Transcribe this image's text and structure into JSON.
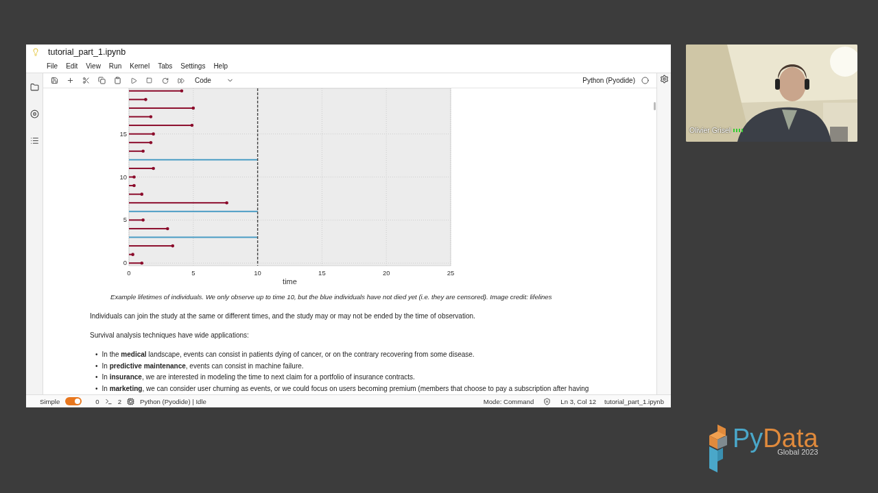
{
  "window": {
    "title": "tutorial_part_1.ipynb"
  },
  "menu": [
    "File",
    "Edit",
    "View",
    "Run",
    "Kernel",
    "Tabs",
    "Settings",
    "Help"
  ],
  "toolbar": {
    "cell_type": "Code",
    "kernel": "Python (Pyodide)"
  },
  "notebook": {
    "chart_data": {
      "type": "bar",
      "orientation": "horizontal",
      "xlabel": "time",
      "x": [
        0,
        1,
        2,
        3,
        4,
        5,
        6,
        7,
        8,
        9,
        10,
        11,
        12,
        13,
        14,
        15,
        16,
        17,
        18,
        19,
        20
      ],
      "grid": true,
      "series": [
        {
          "color": "#8b0a2a",
          "values": [
            1.0,
            0.3,
            3.4,
            null,
            3.0,
            1.1,
            null,
            7.6,
            1.0,
            0.4,
            0.4,
            1.9,
            null,
            1.1,
            1.7,
            1.9,
            4.9,
            1.7,
            5.0,
            1.3,
            4.1
          ]
        },
        {
          "color": "#4a9cc4",
          "values": [
            null,
            null,
            null,
            10,
            null,
            null,
            10,
            null,
            null,
            null,
            null,
            null,
            10,
            null,
            null,
            null,
            null,
            null,
            null,
            null,
            null
          ]
        }
      ],
      "xlim": [
        0,
        25
      ],
      "ylim": [
        -0.3,
        20.3
      ],
      "xticks": [
        0,
        5,
        10,
        15,
        20,
        25
      ],
      "yticks": [
        0,
        5,
        10,
        15
      ],
      "ref_lines": [
        {
          "axis": "x",
          "value": 10
        }
      ]
    },
    "caption": "Example lifetimes of individuals. We only observe up to time 10, but the blue individuals have not died yet (i.e. they are censored). Image credit: lifelines",
    "paragraphs": [
      "Individuals can join the study at the same or different times, and the study may or may not be ended by the time of observation.",
      "Survival analysis techniques have wide applications:"
    ],
    "bullets": [
      {
        "marker": "•",
        "text": "In the **medical** landscape, events can consist in patients dying of cancer, or on the contrary recovering from some disease."
      },
      {
        "marker": "•",
        "text": "In **predictive maintenance**, events can consist in machine failure."
      },
      {
        "marker": "•",
        "text": "In **insurance**, we are interested in modeling the time to next claim for a portfolio of insurance contracts."
      },
      {
        "marker": "•",
        "text": "In **marketing**, we can consider user churning as events, or we could focus on users becoming premium (members that choose to pay a subscription after having"
      }
    ]
  },
  "status_bar": {
    "simple_label": "Simple",
    "simple_on": true,
    "terminals": "0",
    "kernels": "2",
    "kernel_status": "Python (Pyodide) | Idle",
    "mode": "Mode: Command",
    "position": "Ln 3, Col 12",
    "file": "tutorial_part_1.ipynb"
  },
  "video": {
    "name": "Olivier Grisel"
  },
  "logo": {
    "prefix": "Py",
    "suffix": "Data",
    "subtitle": "Global 2023"
  }
}
